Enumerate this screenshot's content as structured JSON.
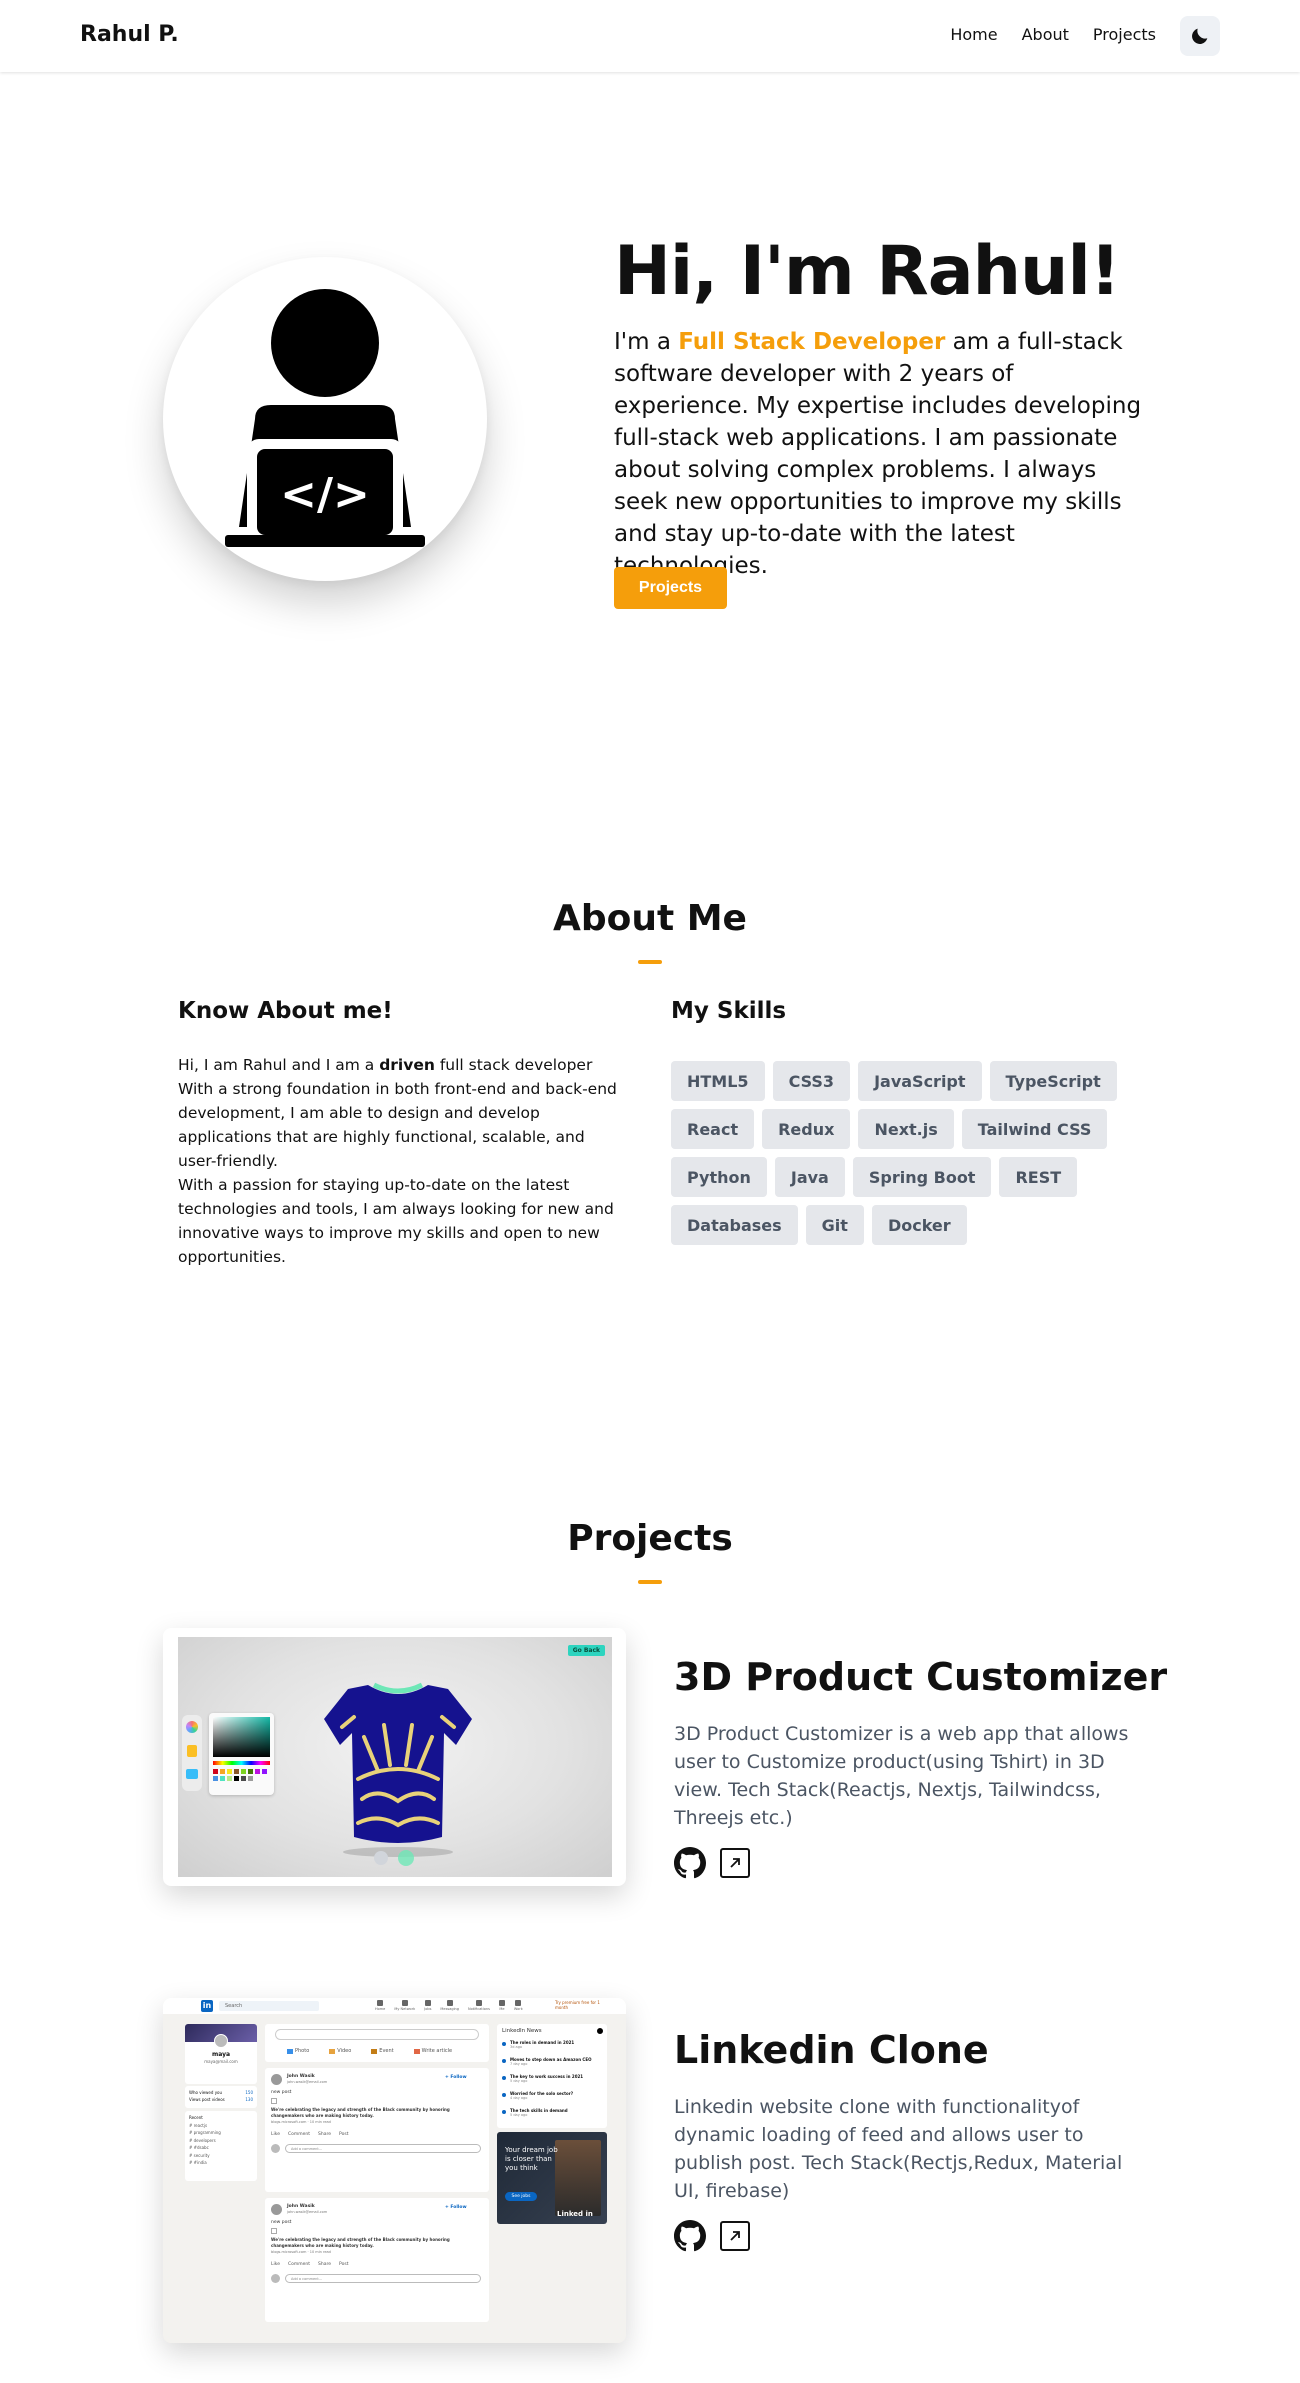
{
  "nav": {
    "brand": "Rahul P.",
    "links": [
      "Home",
      "About",
      "Projects"
    ],
    "theme_icon": "moon-icon"
  },
  "hero": {
    "title": "Hi, I'm Rahul!",
    "desc_prefix": "I'm a ",
    "desc_accent": "Full Stack Developer",
    "desc_rest": " am a full-stack software developer with 2 years of experience. My expertise includes developing full-stack web applications. I am passionate about solving complex problems. I always seek new opportunities to improve my skills and stay up-to-date with the latest technologies.",
    "button": "Projects",
    "accent_color": "#f59e0b"
  },
  "about": {
    "title": "About Me",
    "know_title": "Know About me!",
    "p1_prefix": "Hi, I am Rahul and I am a ",
    "p1_bold": "driven",
    "p1_rest": " full stack developer With a strong foundation in both front-end and back-end development, I am able to design and develop applications that are highly functional, scalable, and user-friendly.",
    "p2": "With a passion for staying up-to-date on the latest technologies and tools, I am always looking for new and innovative ways to improve my skills and open to new opportunities.",
    "skills_title": "My Skills",
    "skills": [
      "HTML5",
      "CSS3",
      "JavaScript",
      "TypeScript",
      "React",
      "Redux",
      "Next.js",
      "Tailwind CSS",
      "Python",
      "Java",
      "Spring Boot",
      "REST",
      "Databases",
      "Git",
      "Docker"
    ]
  },
  "projects": {
    "title": "Projects",
    "items": [
      {
        "title": "3D Product Customizer",
        "desc": "3D Product Customizer is a web app that allows user to Customize product(using Tshirt) in 3D view. Tech Stack(Reactjs, Nextjs, Tailwindcss, Threejs etc.)",
        "badge": "Go Back"
      },
      {
        "title": "Linkedin Clone",
        "desc": "Linkedin website clone with functionalityof dynamic loading of feed and allows user to publish post. Tech Stack(Rectjs,Redux, Material UI, firebase)"
      }
    ]
  },
  "linkedin_mock": {
    "search": "Search",
    "nav_items": [
      "Home",
      "My Network",
      "Jobs",
      "Messaging",
      "Notifications",
      "Me",
      "Work"
    ],
    "premium": "Try premium free for 1 month",
    "profile_name": "maya",
    "profile_email": "maya@mail.com",
    "stats": [
      [
        "Who viewed you",
        "150"
      ],
      [
        "Views post videos",
        "130"
      ]
    ],
    "recent_title": "Recent",
    "recent": [
      "reactjs",
      "programming",
      "developers",
      "#dsabc",
      "security",
      "#india"
    ],
    "compose": [
      "Photo",
      "Video",
      "Event",
      "Write article"
    ],
    "post_author": "John Wasik",
    "post_email": "john.wasik@email.com",
    "follow": "+ Follow",
    "post_text": "new post",
    "post_headline": "We're celebrating the legacy and strength of the Black community by honoring changemakers who are making history today.",
    "post_link": "blogs.microsoft.com · 10 min read",
    "post_actions": [
      "Like",
      "Comment",
      "Share",
      "Post"
    ],
    "comment_placeholder": "Add a comment...",
    "news_title": "LinkedIn News",
    "news": [
      [
        "The roles in demand in 2021",
        "3d ago"
      ],
      [
        "Moves to step down as Amazon CEO",
        "7 day ago"
      ],
      [
        "The key to work success in 2021",
        "5 day ago"
      ],
      [
        "Worried for the solo sector?",
        "4 day ago"
      ],
      [
        "The tech skills in demand",
        "5 day ago"
      ]
    ],
    "ad_text": "Your dream job is closer than you think",
    "ad_button": "See jobs",
    "ad_brand": "Linked in"
  }
}
